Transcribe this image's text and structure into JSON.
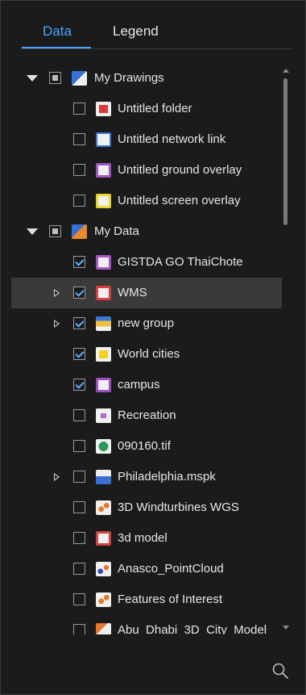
{
  "tabs": {
    "data": "Data",
    "legend": "Legend"
  },
  "tree": {
    "my_drawings": {
      "label": "My Drawings",
      "children": [
        "Untitled folder",
        "Untitled network link",
        "Untitled ground overlay",
        "Untitled screen overlay"
      ]
    },
    "my_data": {
      "label": "My Data",
      "children": [
        "GISTDA GO ThaiChote",
        "WMS",
        "new group",
        "World cities",
        "campus",
        "Recreation",
        "090160.tif",
        "Philadelphia.mspk",
        "3D Windturbines WGS",
        "3d model",
        "Anasco_PointCloud",
        "Features of Interest",
        "Abu_Dhabi_3D_City_Model"
      ]
    }
  },
  "icons": {
    "my_drawings": "drawing-icon",
    "folder": "folder-icon",
    "network_link": "network-link-icon",
    "ground_overlay": "ground-overlay-icon",
    "screen_overlay": "screen-overlay-icon",
    "my_data": "data-icon",
    "search": "search-icon"
  },
  "colors": {
    "accent": "#4aa3ff",
    "background": "#1b1b1b",
    "selected_row": "#3a3a3a"
  }
}
